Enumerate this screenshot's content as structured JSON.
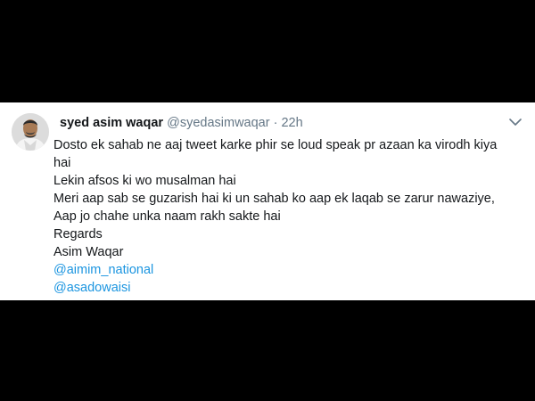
{
  "tweet": {
    "display_name": "syed asim waqar",
    "handle": "@syedasimwaqar",
    "separator": "·",
    "time": "22h",
    "lines": [
      "Dosto ek sahab ne aaj tweet karke phir se loud speak pr azaan ka virodh kiya",
      "hai",
      "Lekin afsos ki wo musalman hai",
      "Meri aap sab se guzarish hai ki un sahab ko aap ek laqab se zarur nawaziye,",
      "Aap jo chahe unka naam rakh sakte hai",
      "Regards",
      "Asim Waqar"
    ],
    "mentions": [
      "@aimim_national",
      "@asadowaisi"
    ]
  },
  "icons": {
    "avatar": "profile-photo",
    "menu": "chevron-down-icon"
  },
  "colors": {
    "background": "#000000",
    "card": "#ffffff",
    "text": "#14171a",
    "muted": "#657786",
    "link": "#1b95e0"
  }
}
